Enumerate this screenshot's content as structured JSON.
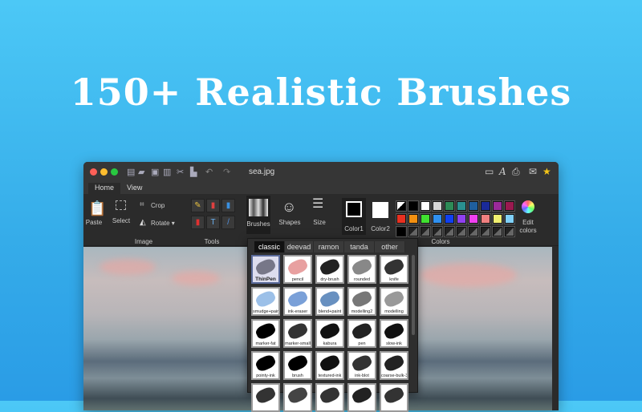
{
  "headline": "150+ Realistic Brushes",
  "window": {
    "title": "sea.jpg"
  },
  "tabs": [
    {
      "label": "Home",
      "active": true
    },
    {
      "label": "View",
      "active": false
    }
  ],
  "ribbon": {
    "paste": "Paste",
    "select": "Select",
    "crop": "Crop",
    "rotate": "Rotate ▾",
    "image_group": "Image",
    "tools_group": "Tools",
    "brushes": "Brushes",
    "shapes": "Shapes",
    "size": "Size",
    "color1": "Color1",
    "color2": "Color2",
    "colors_group": "Colors",
    "edit_colors": "Edit colors"
  },
  "tools": [
    {
      "icon": "pencil-icon",
      "glyph": "✎",
      "color": "#e8c040"
    },
    {
      "icon": "eraser-icon",
      "glyph": "▮",
      "color": "#e04040"
    },
    {
      "icon": "fill-icon",
      "glyph": "▮",
      "color": "#3a90e0"
    },
    {
      "icon": "bucket-icon",
      "glyph": "▮",
      "color": "#e03030"
    },
    {
      "icon": "text-icon",
      "glyph": "T",
      "color": "#6ab0f0"
    },
    {
      "icon": "line-icon",
      "glyph": "/",
      "color": "#5090e0"
    }
  ],
  "palette": [
    [
      "bw",
      "#000000",
      "#ffffff",
      "#d6d6d6",
      "#2e8b57",
      "#2a9090",
      "#1f5f9f",
      "#1a2a9a",
      "#9a2a9a",
      "#9a1a50"
    ],
    [
      "#e83020",
      "#f39010",
      "#40e030",
      "#3090f0",
      "#1040f0",
      "#9040f0",
      "#f040f0",
      "#f08080",
      "#f0f070",
      "#80d0f8"
    ],
    [
      "#000000",
      "diag",
      "diag",
      "diag",
      "diag",
      "diag",
      "diag",
      "diag",
      "diag",
      "diag"
    ]
  ],
  "brush_tabs": [
    {
      "label": "classic",
      "active": true
    },
    {
      "label": "deevad"
    },
    {
      "label": "ramon"
    },
    {
      "label": "tanda"
    },
    {
      "label": "other"
    }
  ],
  "brushes": [
    {
      "name": "ThinPen",
      "selected": true,
      "tone": "#778"
    },
    {
      "name": "pencil",
      "tone": "#e8a0a0"
    },
    {
      "name": "dry-brush",
      "tone": "#222"
    },
    {
      "name": "rounded",
      "tone": "#888"
    },
    {
      "name": "knife",
      "tone": "#333"
    },
    {
      "name": "smudge+paint",
      "tone": "#9cc0e8"
    },
    {
      "name": "ink-eraser",
      "tone": "#7aa0d8"
    },
    {
      "name": "blend+paint",
      "tone": "#6890c0"
    },
    {
      "name": "modelling2",
      "tone": "#777"
    },
    {
      "name": "modelling",
      "tone": "#999"
    },
    {
      "name": "marker-fat",
      "tone": "#000"
    },
    {
      "name": "marker-small",
      "tone": "#333"
    },
    {
      "name": "kabura",
      "tone": "#111"
    },
    {
      "name": "pen",
      "tone": "#222"
    },
    {
      "name": "slow-ink",
      "tone": "#111"
    },
    {
      "name": "pointy-ink",
      "tone": "#000"
    },
    {
      "name": "brush",
      "tone": "#000"
    },
    {
      "name": "textured-ink",
      "tone": "#111"
    },
    {
      "name": "ink-blot",
      "tone": "#333"
    },
    {
      "name": "coarse-bulk-3",
      "tone": "#222"
    },
    {
      "name": "",
      "tone": "#333"
    },
    {
      "name": "",
      "tone": "#444"
    },
    {
      "name": "",
      "tone": "#333"
    },
    {
      "name": "",
      "tone": "#222"
    },
    {
      "name": "",
      "tone": "#333"
    }
  ]
}
